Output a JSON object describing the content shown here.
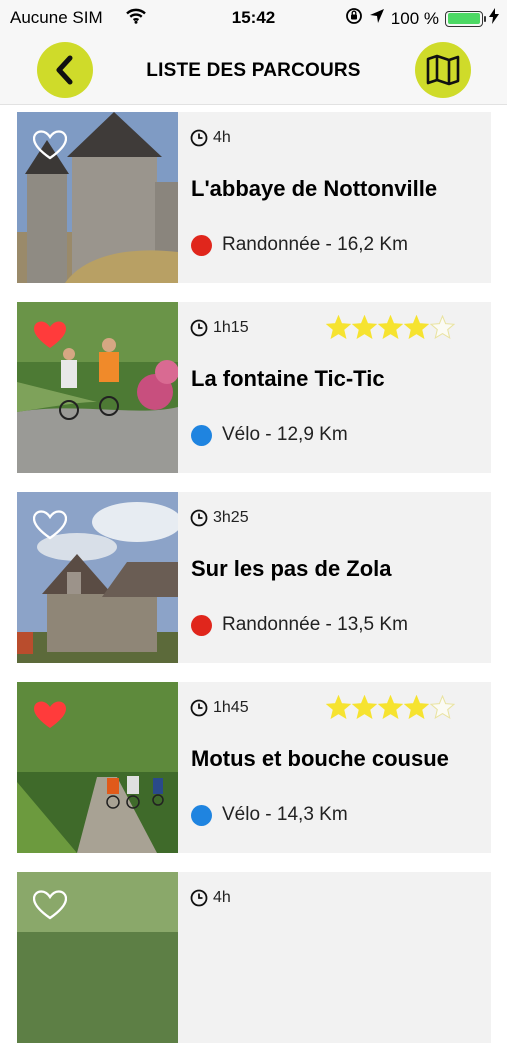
{
  "status_bar": {
    "carrier": "Aucune SIM",
    "time": "15:42",
    "battery": "100 %",
    "battery_level": 1.0
  },
  "header": {
    "title": "LISTE DES PARCOURS",
    "back_icon": "chevron-left-icon",
    "map_icon": "map-icon"
  },
  "colors": {
    "accent": "#cfdb2a",
    "randonnee": "#e0261c",
    "velo": "#1f84e0",
    "star": "#f6e330",
    "favorite": "#ff3b3b"
  },
  "routes": [
    {
      "duration": "4h",
      "title": "L'abbaye de Nottonville",
      "meta": "Randonnée - 16,2 Km",
      "type": "randonnee",
      "favorite": false,
      "rating": null
    },
    {
      "duration": "1h15",
      "title": "La fontaine Tic-Tic",
      "meta": "Vélo - 12,9 Km",
      "type": "velo",
      "favorite": true,
      "rating": 4
    },
    {
      "duration": "3h25",
      "title": "Sur les pas de Zola",
      "meta": "Randonnée - 13,5 Km",
      "type": "randonnee",
      "favorite": false,
      "rating": null
    },
    {
      "duration": "1h45",
      "title": "Motus et bouche cousue",
      "meta": "Vélo - 14,3 Km",
      "type": "velo",
      "favorite": true,
      "rating": 4
    },
    {
      "duration": "4h",
      "title": "",
      "meta": "",
      "type": "randonnee",
      "favorite": false,
      "rating": null
    }
  ]
}
